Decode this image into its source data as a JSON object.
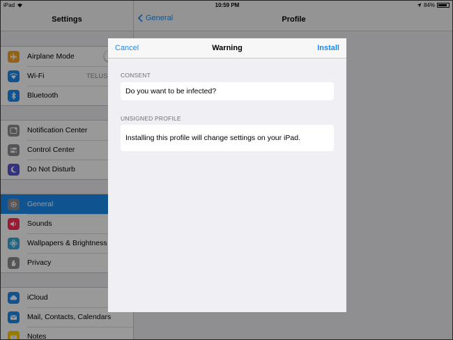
{
  "status_bar": {
    "device": "iPad",
    "time": "10:59 PM",
    "battery": "84%",
    "battery_level": 0.84
  },
  "master": {
    "title": "Settings",
    "groups": [
      {
        "items": [
          {
            "label": "Airplane Mode",
            "icon": "airplane-icon",
            "color": "#f7a325"
          },
          {
            "label": "Wi-Fi",
            "icon": "wifi-icon",
            "color": "#1a8af2",
            "detail": "TELUS"
          },
          {
            "label": "Bluetooth",
            "icon": "bluetooth-icon",
            "color": "#1a8af2"
          }
        ]
      },
      {
        "items": [
          {
            "label": "Notification Center",
            "icon": "notification-center-icon",
            "color": "#8e8e93"
          },
          {
            "label": "Control Center",
            "icon": "control-center-icon",
            "color": "#8e8e93"
          },
          {
            "label": "Do Not Disturb",
            "icon": "moon-icon",
            "color": "#5856d6"
          }
        ]
      },
      {
        "items": [
          {
            "label": "General",
            "icon": "gear-icon",
            "color": "#8e8e93",
            "selected": true
          },
          {
            "label": "Sounds",
            "icon": "sound-icon",
            "color": "#ff2d55"
          },
          {
            "label": "Wallpapers & Brightness",
            "icon": "flower-icon",
            "color": "#34aadc"
          },
          {
            "label": "Privacy",
            "icon": "hand-icon",
            "color": "#8e8e93"
          }
        ]
      },
      {
        "items": [
          {
            "label": "iCloud",
            "icon": "cloud-icon",
            "color": "#1a8af2"
          },
          {
            "label": "Mail, Contacts, Calendars",
            "icon": "mail-icon",
            "color": "#1a8af2"
          },
          {
            "label": "Notes",
            "icon": "notes-icon",
            "color": "#ffcc00"
          }
        ]
      }
    ]
  },
  "detail": {
    "back_label": "General",
    "title": "Profile"
  },
  "sheet": {
    "cancel_label": "Cancel",
    "title": "Warning",
    "install_label": "Install",
    "consent_header": "CONSENT",
    "consent_text": "Do you want to be infected?",
    "unsigned_header": "UNSIGNED PROFILE",
    "unsigned_text": "Installing this profile will change settings on your iPad."
  },
  "colors": {
    "accent": "#1a8af2",
    "selected_row": "#1a8af2",
    "background": "#efeff4"
  }
}
